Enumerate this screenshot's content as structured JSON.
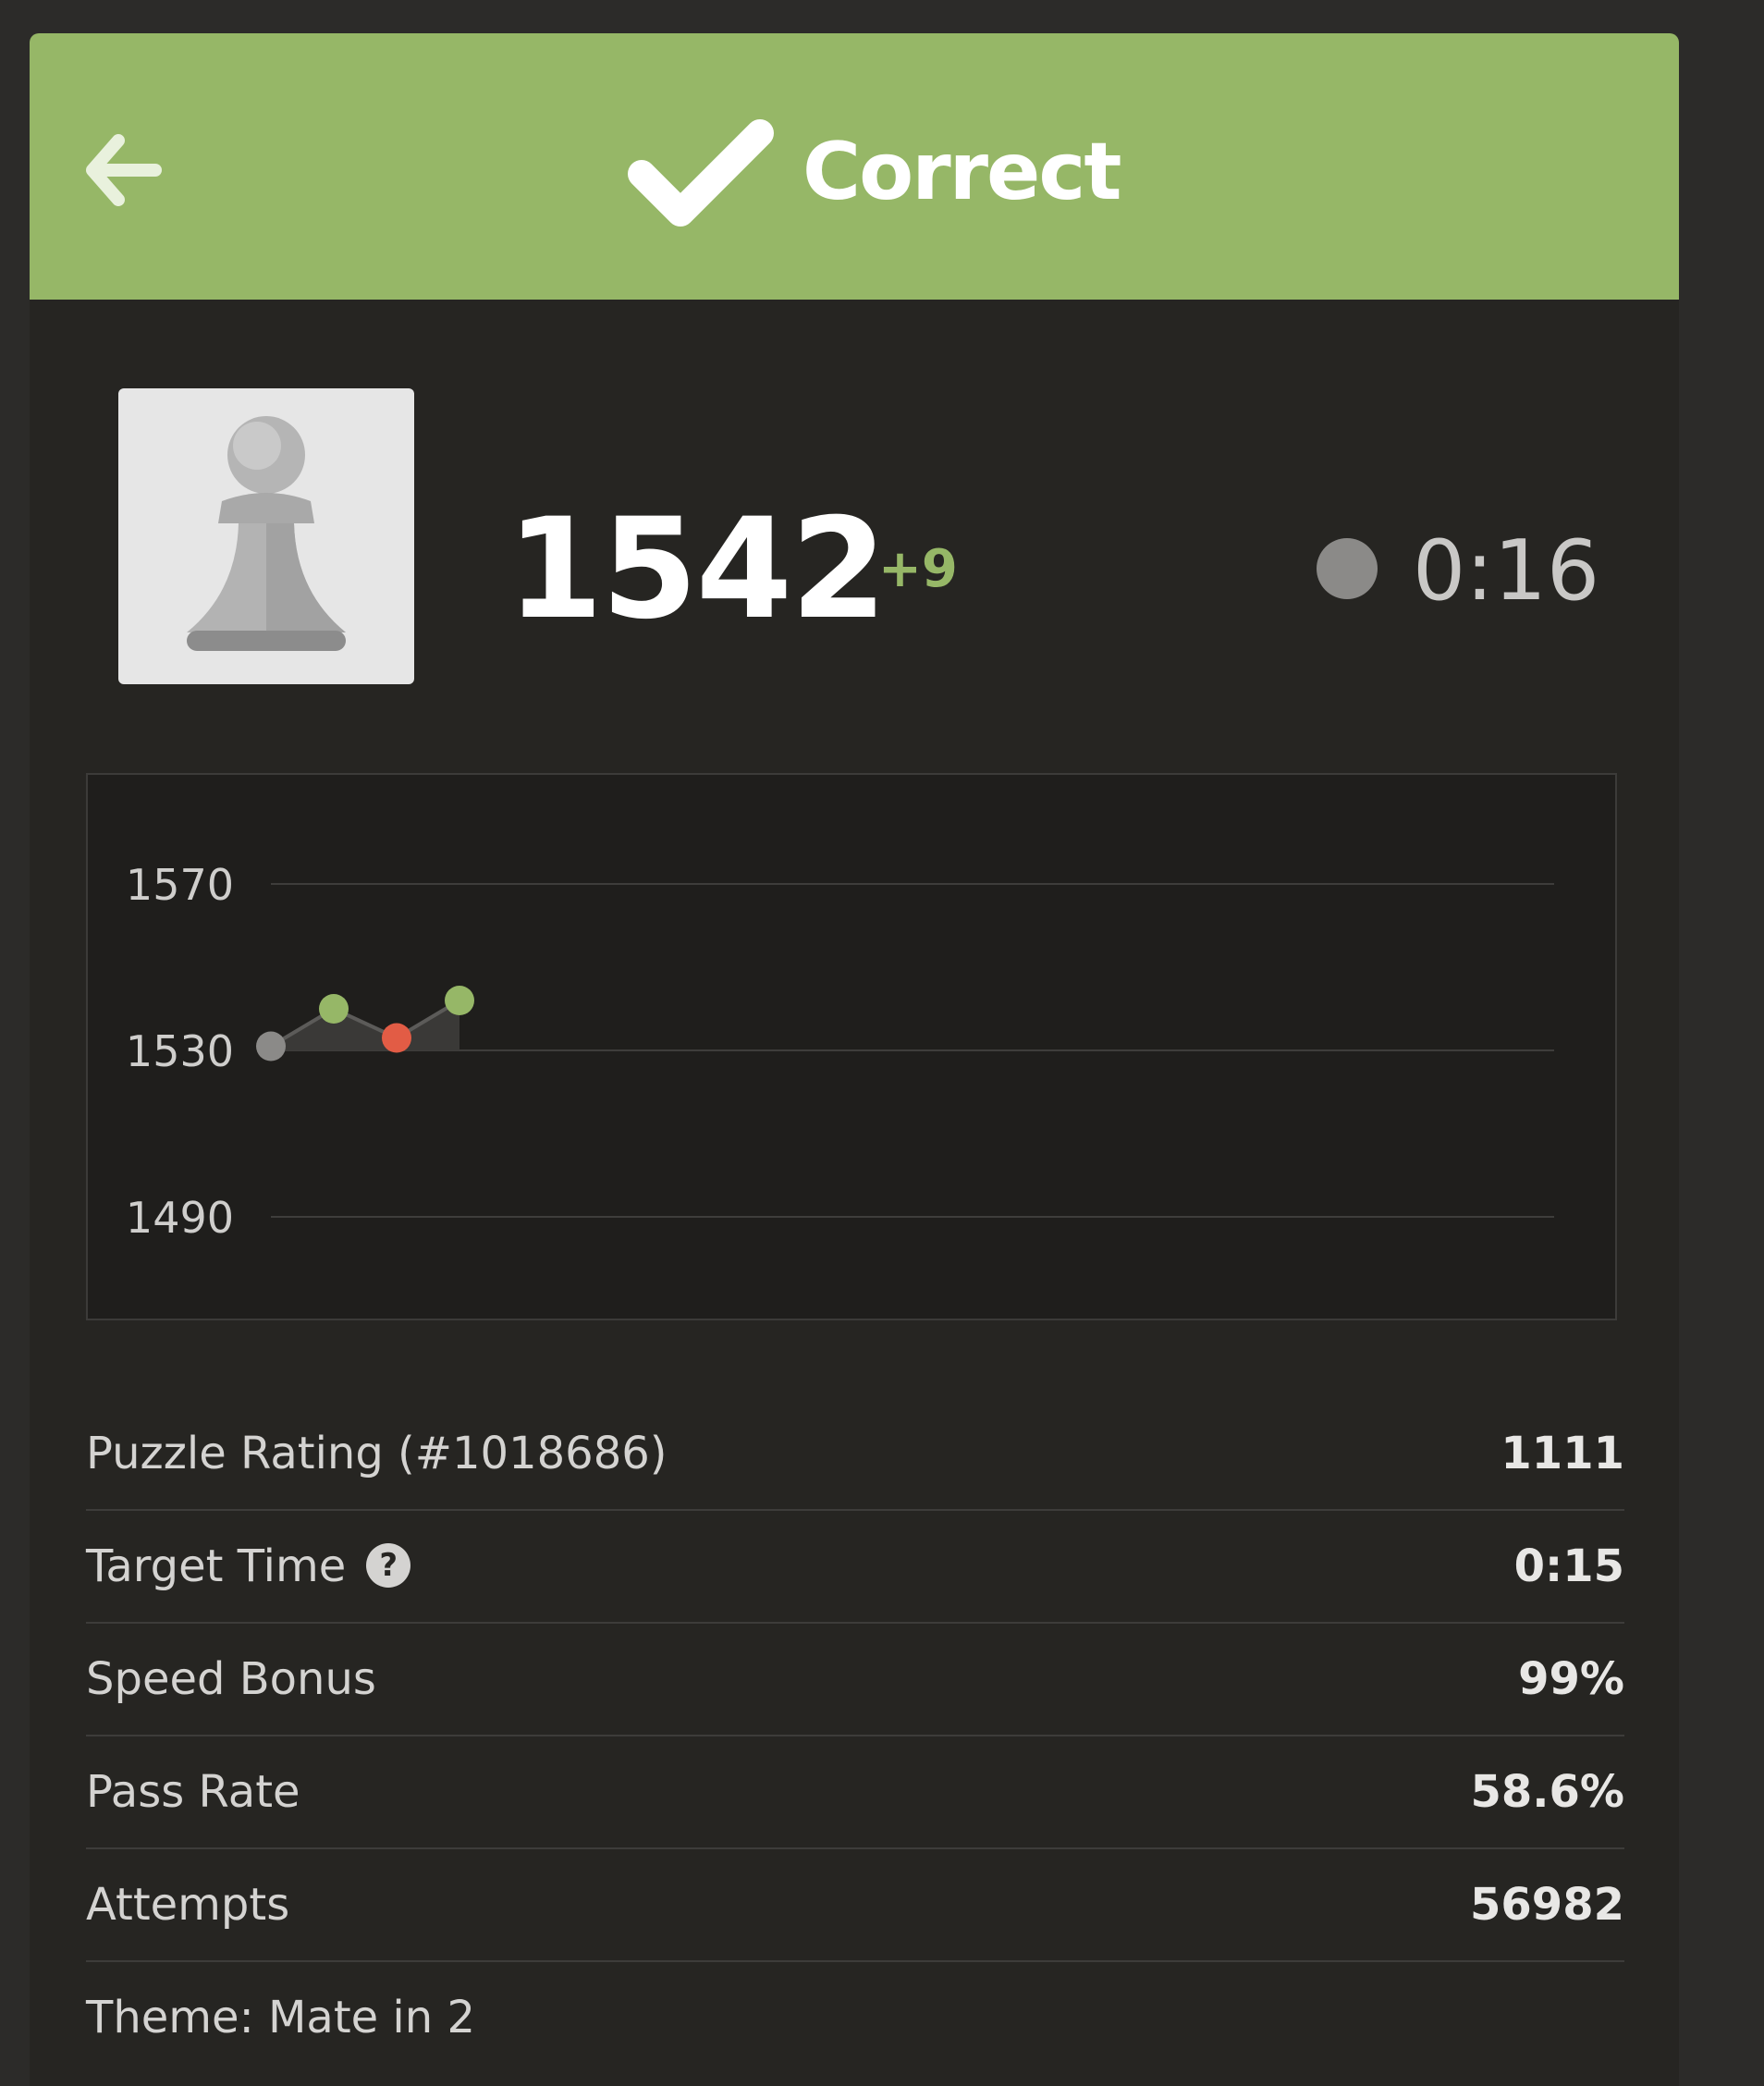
{
  "header": {
    "title": "Correct",
    "back_icon": "arrow-left-icon",
    "status_icon": "checkmark-icon",
    "color": "#96b767"
  },
  "player": {
    "avatar_icon": "pawn-icon",
    "rating": "1542",
    "rating_delta": "+9",
    "clock_time": "0:16"
  },
  "chart_data": {
    "type": "line",
    "y_ticks": [
      "1570",
      "1530",
      "1490"
    ],
    "ylim": [
      1490,
      1570
    ],
    "grid": true,
    "points": [
      {
        "y": 1531,
        "result": "start",
        "color": "#8b8a88"
      },
      {
        "y": 1540,
        "result": "correct",
        "color": "#96b767"
      },
      {
        "y": 1533,
        "result": "incorrect",
        "color": "#e25c45"
      },
      {
        "y": 1542,
        "result": "correct",
        "color": "#96b767"
      }
    ]
  },
  "stats": [
    {
      "label": "Puzzle Rating (#1018686)",
      "value": "1111"
    },
    {
      "label": "Target Time",
      "value": "0:15",
      "help_icon": "?"
    },
    {
      "label": "Speed Bonus",
      "value": "99%"
    },
    {
      "label": "Pass Rate",
      "value": "58.6%"
    },
    {
      "label": "Attempts",
      "value": "56982"
    },
    {
      "label": "Theme: Mate in 2",
      "value": ""
    }
  ]
}
